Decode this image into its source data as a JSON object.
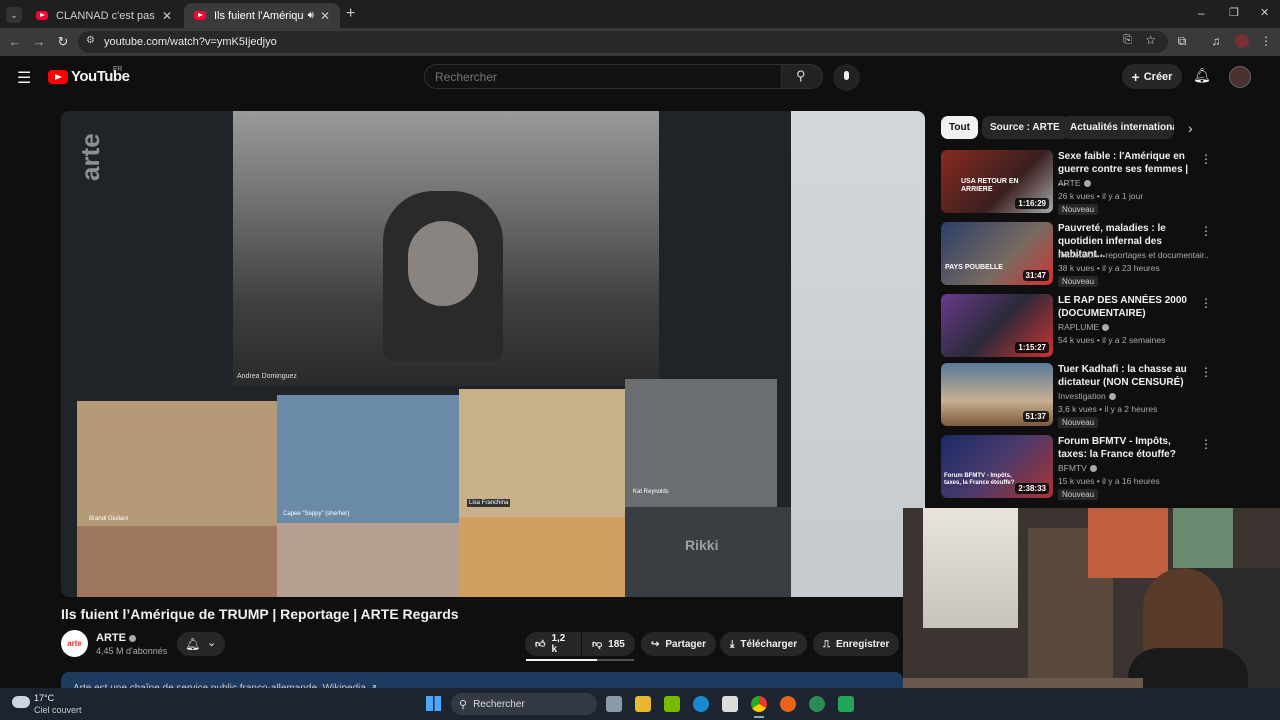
{
  "browser": {
    "tabs": [
      {
        "title": "CLANNAD c'est pas ouf ! - YouTube",
        "active": false
      },
      {
        "title": "Ils fuient l'Amérique de TRUMP",
        "active": true
      }
    ],
    "new_tab": "+",
    "url": "youtube.com/watch?v=ymK5Ijedjyo",
    "window_controls": {
      "minimize": "–",
      "restore": "❐",
      "close": "✕"
    }
  },
  "youtube": {
    "logo_text": "YouTube",
    "country_code": "FR",
    "search_placeholder": "Rechercher",
    "create_label": "Créer"
  },
  "video": {
    "title": "Ils fuient l’Amérique de TRUMP | Reportage | ARTE Regards",
    "channel": "ARTE",
    "channel_avatar_text": "arte",
    "subscribers": "4,45 M d'abonnés",
    "likes": "1,2 k",
    "dislikes": "185",
    "share_label": "Partager",
    "download_label": "Télécharger",
    "save_label": "Enregistrer",
    "description_snippet": "Arte est une chaîne de service public franco-allemande. Wikipedia ↗",
    "overlay": {
      "watermark": "arte",
      "participant_main": "Andrea Dominguez",
      "participant_2": "Brandi Giuliani",
      "participant_3": "Capee \"Seppy\" (she/her)",
      "participant_4": "Lisa Franchina",
      "participant_5": "Kat Reynolds",
      "participant_6": "Rikki"
    }
  },
  "chips": [
    {
      "label": "Tout",
      "active": true
    },
    {
      "label": "Source : ARTE",
      "active": false
    },
    {
      "label": "Actualités internationales",
      "active": false
    }
  ],
  "recommendations": [
    {
      "title": "Sexe faible : l'Amérique en guerre contre ses femmes | ...",
      "channel": "ARTE",
      "verified": true,
      "meta": "26 k vues • il y a 1 jour",
      "badge": "Nouveau",
      "duration": "1:16:29",
      "thumb_text": "USA RETOUR EN ARRIERE",
      "color": "#8a2a20"
    },
    {
      "title": "Pauvreté, maladies : le quotidien infernal des habitant...",
      "channel": "Immersion • reportages et documentair...",
      "verified": false,
      "meta": "38 k vues • il y a 23 heures",
      "badge": "Nouveau",
      "duration": "31:47",
      "thumb_text": "PAYS POUBELLE",
      "color": "#2a3f6a"
    },
    {
      "title": "LE RAP DES ANNÉES 2000 (DOCUMENTAIRE)",
      "channel": "RAPLUME",
      "verified": true,
      "meta": "54 k vues • il y a 2 semaines",
      "badge": "",
      "duration": "1:15:27",
      "thumb_text": "",
      "color": "#6a3a8a"
    },
    {
      "title": "Tuer Kadhafi : la chasse au dictateur (NON CENSURÉ)",
      "channel": "Investigation",
      "verified": true,
      "meta": "3,6 k vues • il y a 2 heures",
      "badge": "Nouveau",
      "duration": "51:37",
      "thumb_text": "",
      "color": "#5a7a9a"
    },
    {
      "title": "Forum BFMTV - Impôts, taxes: la France étouffe?",
      "channel": "BFMTV",
      "verified": true,
      "meta": "15 k vues • il y a 16 heures",
      "badge": "Nouveau",
      "duration": "2:38:33",
      "thumb_text": "Forum BFMTV - Impôts, taxes, la France étouffe?",
      "color": "#1a2a6a"
    }
  ],
  "taskbar": {
    "temperature": "17°C",
    "weather": "Ciel couvert",
    "search_label": "Rechercher"
  }
}
